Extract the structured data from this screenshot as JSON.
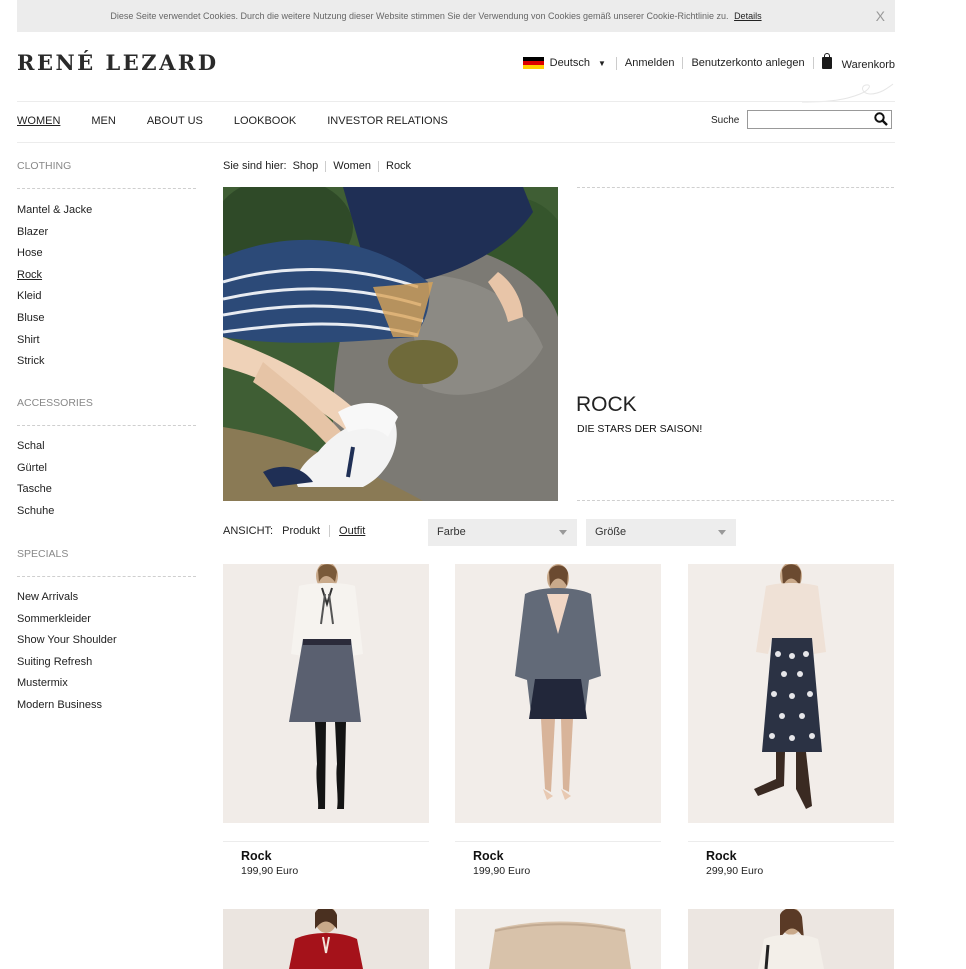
{
  "cookie": {
    "text": "Diese Seite verwendet Cookies. Durch die weitere Nutzung dieser Website stimmen Sie der Verwendung von Cookies gemäß unserer Cookie-Richtlinie zu.",
    "link": "Details",
    "close": "X"
  },
  "brand": {
    "logo": "RENÉ LEZARD"
  },
  "top_nav": {
    "language": "Deutsch",
    "login": "Anmelden",
    "register": "Benutzerkonto anlegen",
    "cart": "Warenkorb"
  },
  "main_nav": {
    "items": [
      "WOMEN",
      "MEN",
      "ABOUT US",
      "LOOKBOOK",
      "INVESTOR RELATIONS"
    ],
    "active": "WOMEN"
  },
  "search": {
    "label": "Suche",
    "value": ""
  },
  "sidebar": {
    "clothing": {
      "title": "CLOTHING",
      "items": [
        "Mantel & Jacke",
        "Blazer",
        "Hose",
        "Rock",
        "Kleid",
        "Bluse",
        "Shirt",
        "Strick"
      ],
      "active": "Rock"
    },
    "accessories": {
      "title": "ACCESSORIES",
      "items": [
        "Schal",
        "Gürtel",
        "Tasche",
        "Schuhe"
      ]
    },
    "specials": {
      "title": "SPECIALS",
      "items": [
        "New Arrivals",
        "Sommerkleider",
        "Show Your Shoulder",
        "Suiting Refresh",
        "Mustermix",
        "Modern Business"
      ]
    }
  },
  "breadcrumb": {
    "label": "Sie sind hier:",
    "items": [
      "Shop",
      "Women",
      "Rock"
    ]
  },
  "hero": {
    "title": "ROCK",
    "subtitle": "DIE STARS DER SAISON!"
  },
  "view": {
    "label": "ANSICHT:",
    "product": "Produkt",
    "outfit": "Outfit",
    "active": "Outfit"
  },
  "filters": {
    "color": "Farbe",
    "size": "Größe"
  },
  "products": [
    {
      "name": "Rock",
      "price": "199,90 Euro"
    },
    {
      "name": "Rock",
      "price": "199,90 Euro"
    },
    {
      "name": "Rock",
      "price": "299,90 Euro"
    }
  ],
  "colors": {
    "accent": "#1a1a1a",
    "muted": "#888888",
    "panel": "#ececec"
  }
}
